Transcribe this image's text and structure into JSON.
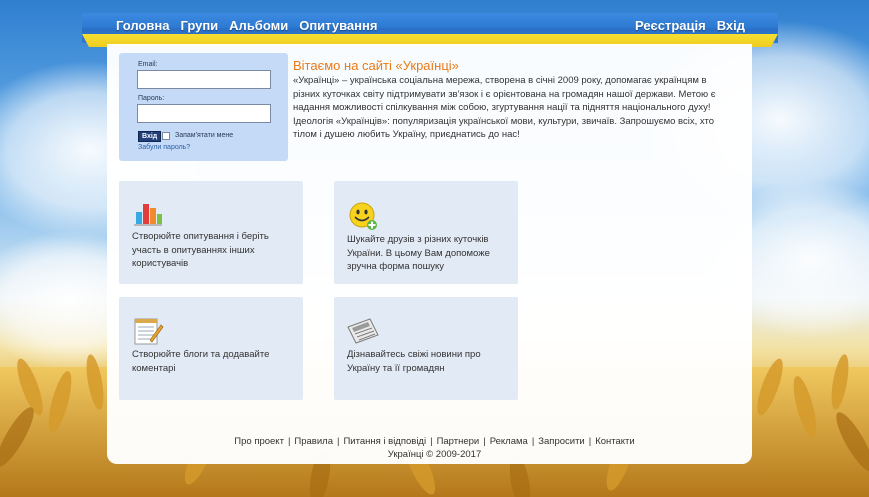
{
  "nav": {
    "left": [
      "Головна",
      "Групи",
      "Альбоми",
      "Опитування"
    ],
    "right": [
      "Реєстрація",
      "Вхід"
    ]
  },
  "login": {
    "email_label": "Email:",
    "password_label": "Пароль:",
    "submit_label": "Вхід",
    "remember_label": "Запам'ятати мене",
    "forgot_label": "Забули пароль?"
  },
  "welcome": {
    "title": "Вітаємо на сайті «Українці»",
    "text": "«Українці» – українська соціальна мережа, створена в січні 2009 року, допомагає українцям в різних куточках світу підтримувати зв'язок і є орієнтована на громадян нашої держави. Метою є надання можливості спілкування між собою, згуртування нації та підняття національного духу! Ідеологія «Українців»: популяризація української мови, культури, звичаїв. Запрошуємо всіх, хто тілом і душею любить Україну, приєднатись до нас!"
  },
  "features": [
    {
      "icon": "bar-chart-icon",
      "text": "Створюйте опитування і беріть участь в опитуваннях інших користувачів"
    },
    {
      "icon": "smiley-add-icon",
      "text": "Шукайте друзів з різних куточків України. В цьому Вам допоможе зручна форма пошуку"
    },
    {
      "icon": "notepad-icon",
      "text": "Створюйте блоги та додавайте коментарі"
    },
    {
      "icon": "newspaper-icon",
      "text": "Дізнавайтесь свіжі новини про Україну та її громадян"
    }
  ],
  "footer": {
    "links": [
      "Про проект",
      "Правила",
      "Питання і відповіді",
      "Партнери",
      "Реклама",
      "Запросити",
      "Контакти"
    ],
    "copyright": "Українці © 2009-2017"
  },
  "colors": {
    "nav_blue": "#2d79d2",
    "nav_yellow": "#f6df33",
    "title_orange": "#e87a18",
    "login_bg": "#c4daf6",
    "card_bg": "#e2eaf5"
  }
}
